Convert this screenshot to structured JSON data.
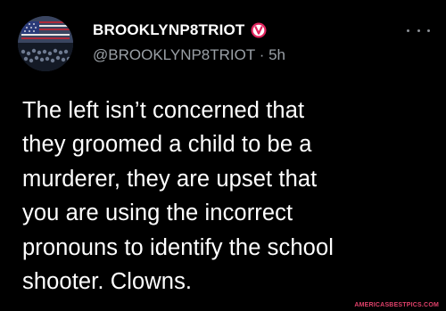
{
  "account": {
    "display_name": "BROOKLYNP8TRIOT",
    "handle": "@BROOKLYNP8TRIOT",
    "separator": "·",
    "time": "5h",
    "verified_badge_icon": "verified-badge-icon",
    "badge_color": "#e0245e"
  },
  "more_menu_icon": "more-horizontal-icon",
  "tweet": {
    "lines": [
      "The left isn’t concerned that",
      "they groomed a child to be a",
      "murderer, they are upset that",
      "you are using the incorrect",
      "pronouns to identify the school",
      "shooter. Clowns."
    ]
  },
  "watermark": {
    "text": "AMERICASBESTPICS.COM"
  },
  "colors": {
    "background": "#000000",
    "text": "#ffffff",
    "muted": "#9aa0a6"
  }
}
